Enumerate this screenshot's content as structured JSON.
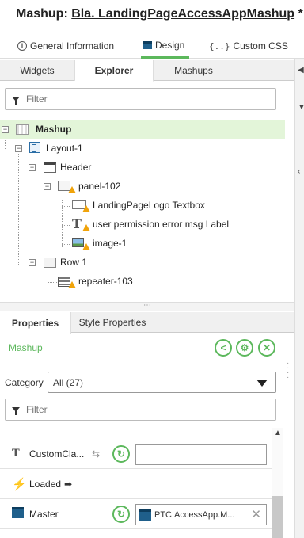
{
  "window": {
    "title_prefix": "Mashup:",
    "title_name": "Bla. LandingPageAccessAppMashup",
    "dirty_marker": "*"
  },
  "top_tabs": [
    {
      "label": "General Information",
      "icon": "info-icon"
    },
    {
      "label": "Design",
      "icon": "design-icon",
      "active": true
    },
    {
      "label": "Custom CSS",
      "icon": "{..}"
    }
  ],
  "explorer_tabs": [
    "Widgets",
    "Explorer",
    "Mashups"
  ],
  "explorer_active": "Explorer",
  "explorer_filter_placeholder": "Filter",
  "tree": [
    {
      "label": "Mashup",
      "icon": "mashup-icon",
      "selected": true
    },
    {
      "label": "Layout-1",
      "icon": "layout-icon"
    },
    {
      "label": "Header",
      "icon": "header-icon"
    },
    {
      "label": "panel-102",
      "icon": "panel-icon",
      "warning": true
    },
    {
      "label": "LandingPageLogo Textbox",
      "icon": "textbox-icon",
      "warning": true
    },
    {
      "label": "user permission error msg Label",
      "icon": "label-icon",
      "warning": true
    },
    {
      "label": "image-1",
      "icon": "image-icon",
      "warning": true
    },
    {
      "label": "Row 1",
      "icon": "row-icon"
    },
    {
      "label": "repeater-103",
      "icon": "repeater-icon",
      "warning": true
    }
  ],
  "property_tabs": [
    "Properties",
    "Style Properties"
  ],
  "property_active": "Properties",
  "selected_widget": "Mashup",
  "category": {
    "label": "Category",
    "value": "All (27)"
  },
  "property_filter_placeholder": "Filter",
  "properties": [
    {
      "name": "CustomCla...",
      "icon": "text-icon",
      "input_value": ""
    },
    {
      "name": "Loaded",
      "icon": "lightning-icon",
      "event_arrow": "➡"
    },
    {
      "name": "Master",
      "icon": "master-icon",
      "input_value": "PTC.AccessApp.M..."
    }
  ],
  "colors": {
    "accent": "#5cb85c",
    "selected_row": "#e3f5d9",
    "warning": "#f0a30a"
  }
}
